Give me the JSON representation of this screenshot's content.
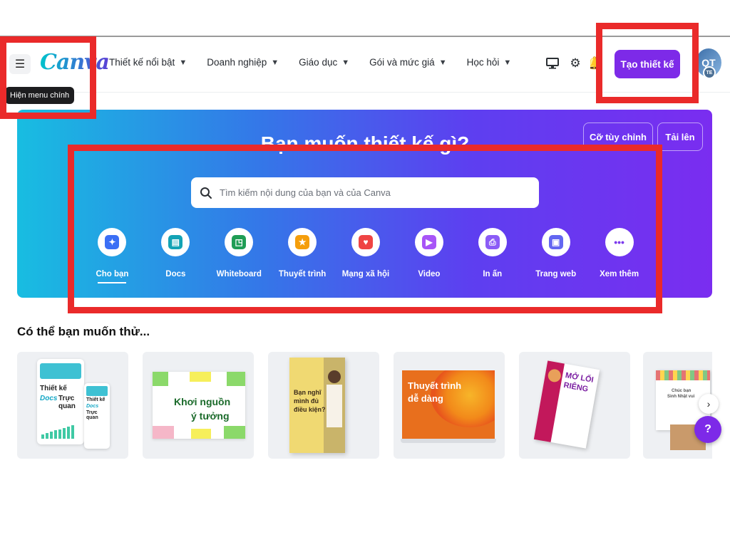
{
  "header": {
    "menu_icon": "hamburger-icon",
    "menu_tooltip": "Hiện menu chính",
    "logo": "Canva",
    "nav": [
      {
        "label": "Thiết kế nổi bật"
      },
      {
        "label": "Doanh nghiệp"
      },
      {
        "label": "Giáo dục"
      },
      {
        "label": "Gói và mức giá"
      },
      {
        "label": "Học hỏi"
      }
    ],
    "icons": [
      "desktop-icon",
      "gear-icon",
      "bell-icon"
    ],
    "create_button": "Tạo thiết kế",
    "avatar_initials": "QT",
    "avatar_badge": "TE"
  },
  "hero": {
    "title": "Bạn muốn thiết kế gì?",
    "custom_size_button": "Cỡ tùy chỉnh",
    "upload_button": "Tải lên",
    "search_placeholder": "Tìm kiếm nội dung của bạn và của Canva",
    "categories": [
      {
        "label": "Cho bạn",
        "icon": "sparkle-icon",
        "color": "#3b6ff5",
        "selected": true
      },
      {
        "label": "Docs",
        "icon": "docs-icon",
        "color": "#13a3b5"
      },
      {
        "label": "Whiteboard",
        "icon": "whiteboard-icon",
        "color": "#1f9d55"
      },
      {
        "label": "Thuyết trình",
        "icon": "presentation-icon",
        "color": "#f59e0b"
      },
      {
        "label": "Mạng xã hội",
        "icon": "heart-icon",
        "color": "#ef4444"
      },
      {
        "label": "Video",
        "icon": "video-icon",
        "color": "#a855f7"
      },
      {
        "label": "In ấn",
        "icon": "printer-icon",
        "color": "#8b5cf6"
      },
      {
        "label": "Trang web",
        "icon": "website-icon",
        "color": "#6366f1"
      },
      {
        "label": "Xem thêm",
        "icon": "more-icon",
        "color": "#7c3aed"
      }
    ]
  },
  "suggestions": {
    "title": "Có thể bạn muốn thử...",
    "cards": [
      {
        "name": "docs",
        "lines": [
          "Thiết kế",
          "Docs",
          "Trực quan"
        ],
        "mini": [
          "Thiết kế",
          "Docs",
          "Trực quan"
        ]
      },
      {
        "name": "whiteboard",
        "lines": [
          "Khơi nguồn",
          "ý tưởng"
        ]
      },
      {
        "name": "poster",
        "lines": [
          "Bạn nghĩ",
          "mình đủ",
          "điều kiện?"
        ]
      },
      {
        "name": "presentation",
        "lines": [
          "Thuyết trình",
          "dễ dàng"
        ]
      },
      {
        "name": "flyer",
        "lines": [
          "MỞ LỐI",
          "RIÊNG"
        ]
      },
      {
        "name": "card",
        "lines": [
          "Chúc bạn",
          "Sinh Nhật vui"
        ]
      }
    ],
    "scroll_icon": "chevron-right-icon",
    "help_label": "?"
  },
  "colors": {
    "accent": "#7d2ae8",
    "highlight_box": "#ea2a2a"
  }
}
